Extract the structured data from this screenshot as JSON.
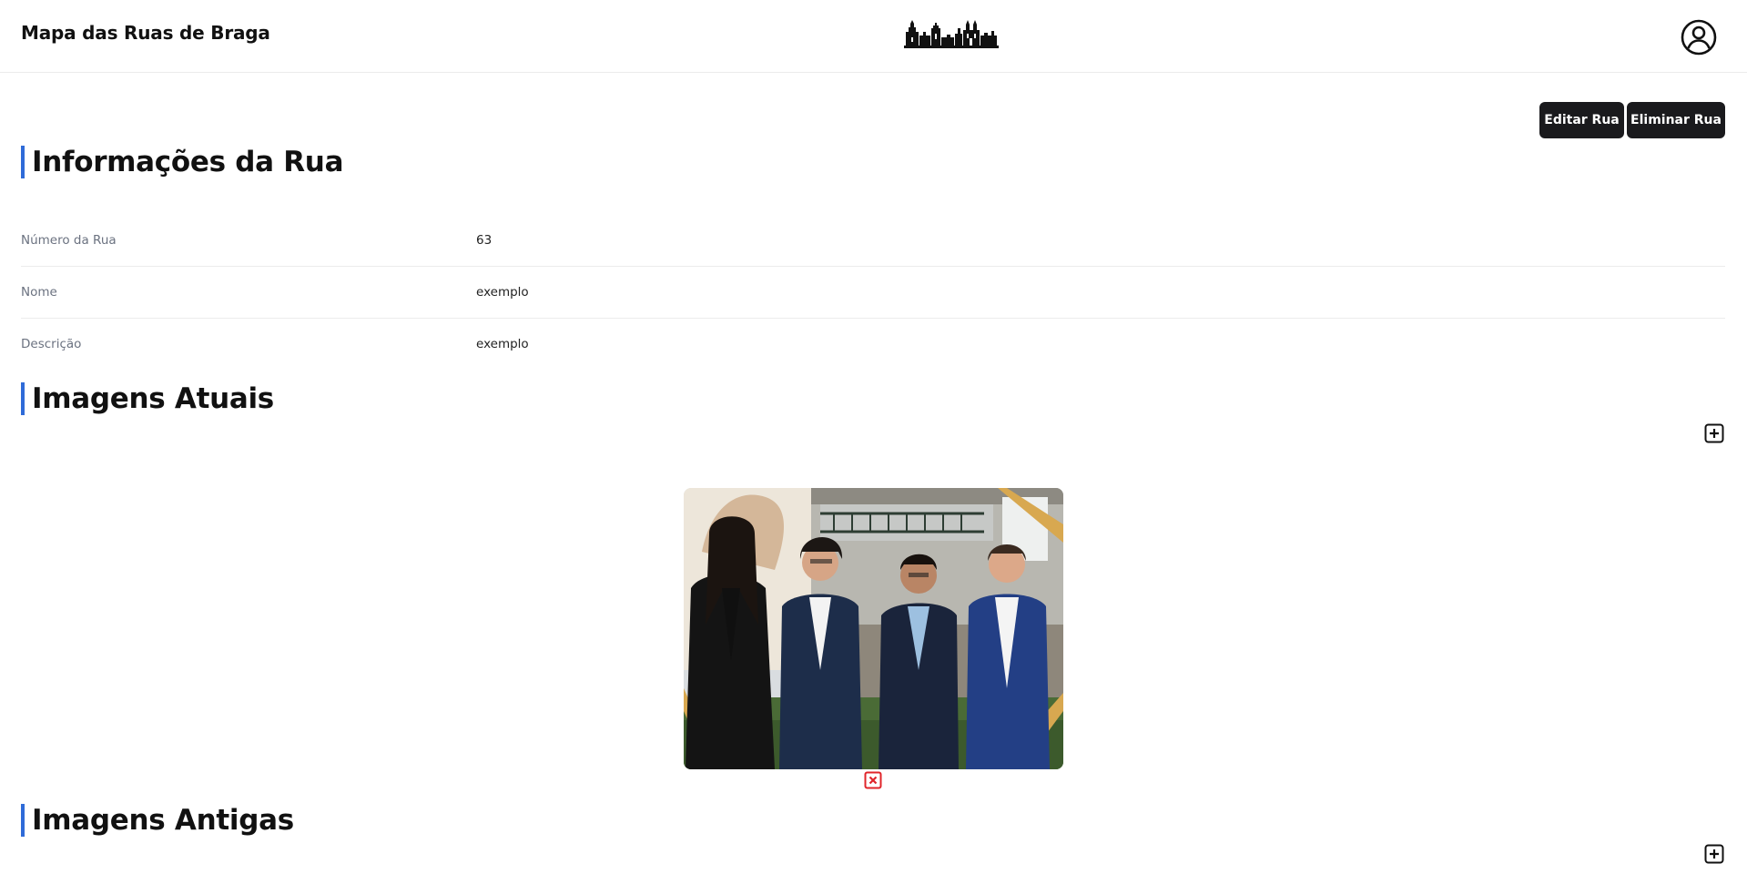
{
  "header": {
    "title": "Mapa das Ruas de Braga",
    "logo_icon": "braga-skyline-logo",
    "profile_icon": "user-circle-icon"
  },
  "actions": {
    "edit_label": "Editar Rua",
    "delete_label": "Eliminar Rua"
  },
  "sections": {
    "info_title": "Informações da Rua",
    "current_images_title": "Imagens Atuais",
    "old_images_title": "Imagens Antigas"
  },
  "info": {
    "rows": [
      {
        "label": "Número da Rua",
        "value": "63"
      },
      {
        "label": "Nome",
        "value": "exemplo"
      },
      {
        "label": "Descrição",
        "value": "exemplo"
      }
    ]
  },
  "images": {
    "current": [
      {
        "subject": "four young men in suits standing in front of a building",
        "remove_icon": "close-icon"
      }
    ],
    "add_icon": "plus-square-icon"
  },
  "colors": {
    "accent": "#2f6bd8",
    "button_bg": "#1a1a1d",
    "remove": "#e0242a",
    "label": "#6b7280"
  }
}
